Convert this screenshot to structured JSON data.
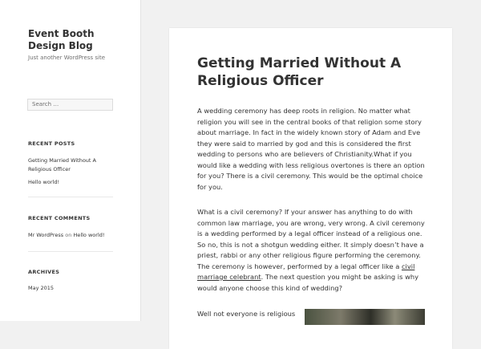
{
  "site": {
    "title": "Event Booth Design Blog",
    "description": "Just another WordPress site"
  },
  "search": {
    "placeholder": "Search …"
  },
  "recent_posts": {
    "title": "RECENT POSTS",
    "items": [
      "Getting Married Without A Religious Officer",
      "Hello world!"
    ]
  },
  "recent_comments": {
    "title": "RECENT COMMENTS",
    "author": "Mr WordPress",
    "on": "on",
    "post": "Hello world!"
  },
  "archives": {
    "title": "ARCHIVES",
    "items": [
      "May 2015"
    ]
  },
  "post": {
    "title": "Getting Married Without A Religious Officer",
    "paragraph1": "A wedding ceremony has deep roots in religion. No matter what religion you will see in the central books of that religion some story about marriage. In fact in the widely known story of Adam and Eve they were said to married by god and this is considered the first wedding to persons who are believers of Christianity.What if you would like a wedding with less religious overtones is there an option for you? There is a civil ceremony. This would be the optimal choice for you.",
    "paragraph2_before": "What is a civil ceremony? If your answer has anything to do with common law marriage, you are wrong, very wrong. A civil ceremony is a wedding performed by a legal officer instead of a religious one. So no, this is not a shotgun wedding either. It simply doesn’t have a priest, rabbi or any other religious figure performing the ceremony. The ceremony is however, performed by a legal officer like a ",
    "paragraph2_link": "civil marriage celebrant",
    "paragraph2_after": ". The next question you might be asking is why would anyone choose this kind of wedding?",
    "paragraph3": "Well not everyone is religious"
  }
}
